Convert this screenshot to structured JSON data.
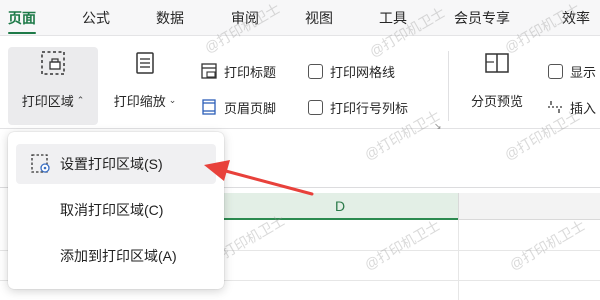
{
  "tabs": [
    {
      "label": "页面",
      "active": true
    },
    {
      "label": "公式"
    },
    {
      "label": "数据"
    },
    {
      "label": "审阅"
    },
    {
      "label": "视图"
    },
    {
      "label": "工具"
    },
    {
      "label": "会员专享"
    },
    {
      "label": "效率"
    }
  ],
  "ribbon": {
    "print_area": "打印区域",
    "print_scale": "打印缩放",
    "print_titles": "打印标题",
    "header_footer": "页眉页脚",
    "print_gridlines": "打印网格线",
    "print_row_col_headers": "打印行号列标",
    "page_break_preview": "分页预览",
    "show": "显示",
    "insert": "插入"
  },
  "dropdown": {
    "items": [
      {
        "label": "设置打印区域(S)"
      },
      {
        "label": "取消打印区域(C)"
      },
      {
        "label": "添加到打印区域(A)"
      }
    ]
  },
  "sheet": {
    "selected_column": "D"
  },
  "watermark": "@打印机卫士",
  "colors": {
    "accent_green": "#1e7a48",
    "arrow_red": "#e8413b",
    "column_highlight": "#e3efe6"
  }
}
